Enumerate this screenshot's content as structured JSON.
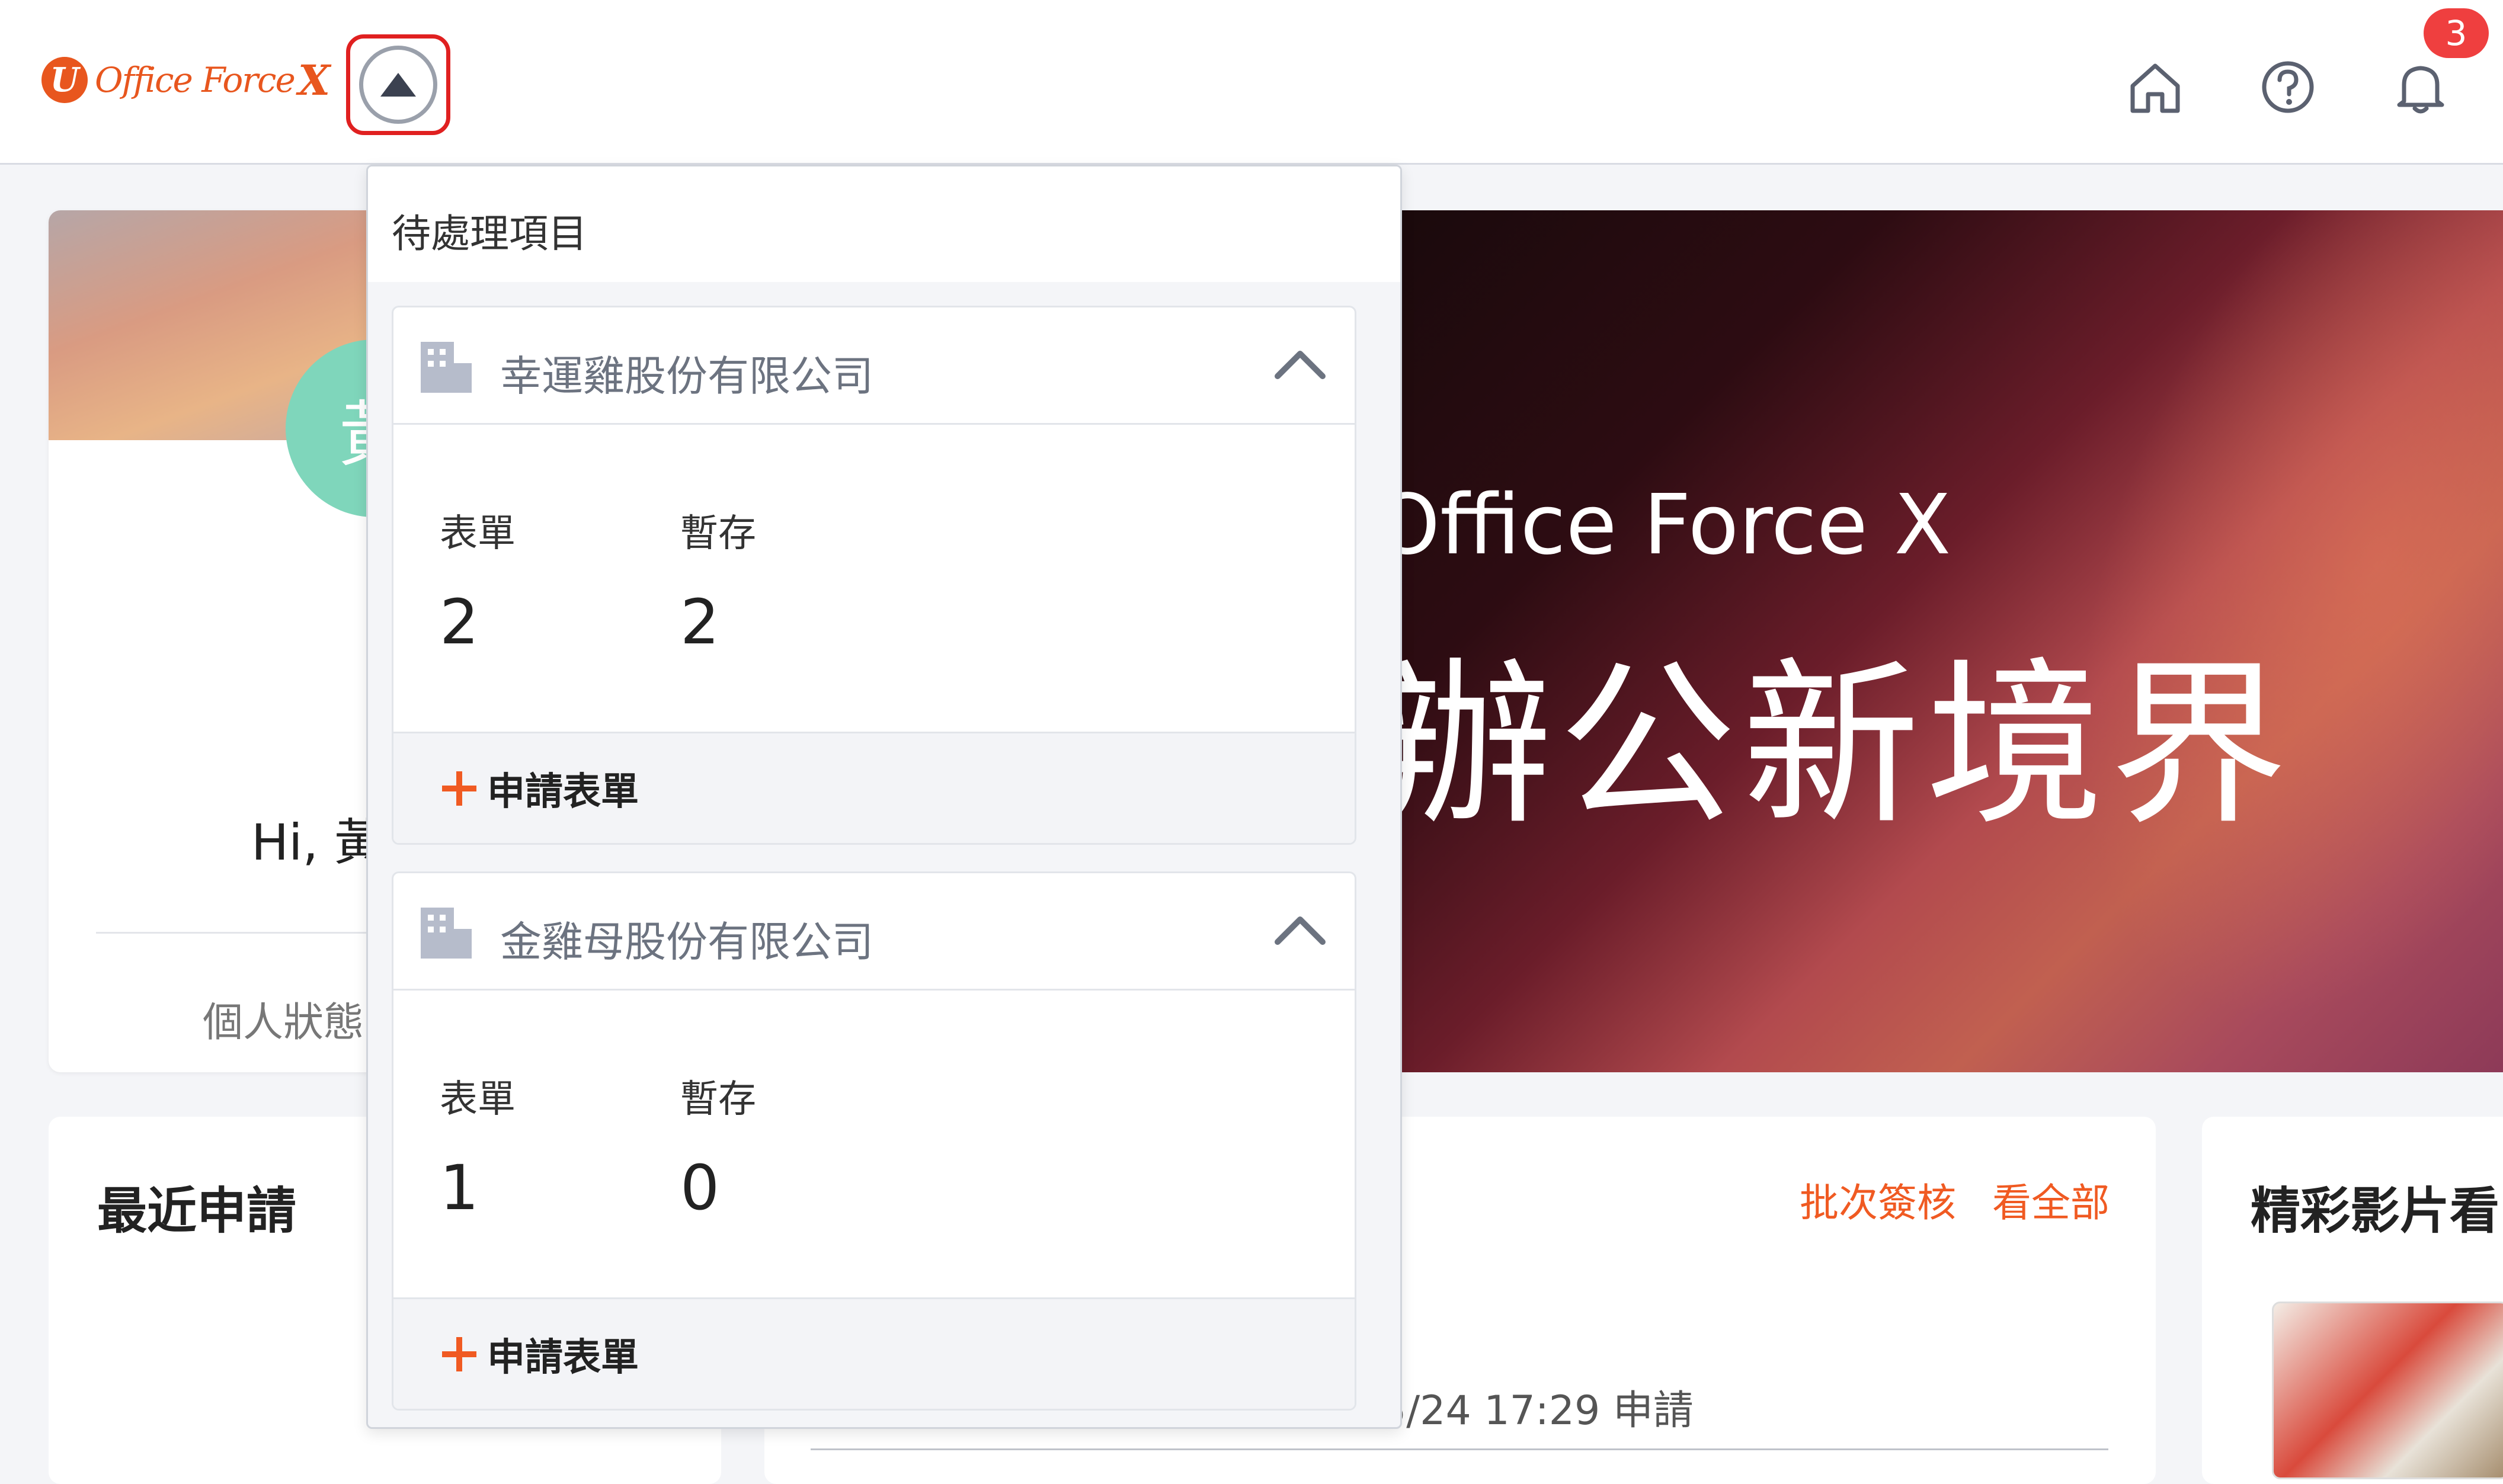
{
  "header": {
    "logo_text": "Office Force",
    "logo_x": "X",
    "logo_mark": "U",
    "notification_count": "3",
    "icons": [
      "home-icon",
      "help-icon",
      "bell-icon"
    ]
  },
  "profile": {
    "avatar_initial": "黃",
    "greeting": "Hi, 黃",
    "status_label": "個人狀態"
  },
  "banner": {
    "line1": "Office Force X",
    "line2": "辦公新境界"
  },
  "recent": {
    "title": "最近申請"
  },
  "approval": {
    "batch_label": "批次簽核",
    "view_all_label": "看全部",
    "time_text": "5/24 17:29  申請"
  },
  "video": {
    "title": "精彩影片看"
  },
  "dropdown": {
    "title": "待處理項目",
    "companies": [
      {
        "name": "幸運雞股份有限公司",
        "form_label": "表單",
        "form_count": "2",
        "draft_label": "暫存",
        "draft_count": "2",
        "apply_label": "申請表單"
      },
      {
        "name": "金雞母股份有限公司",
        "form_label": "表單",
        "form_count": "1",
        "draft_label": "暫存",
        "draft_count": "0",
        "apply_label": "申請表單"
      }
    ]
  },
  "colors": {
    "accent": "#f05a22",
    "badge": "#ef3f3f",
    "highlight_box": "#e02020"
  }
}
